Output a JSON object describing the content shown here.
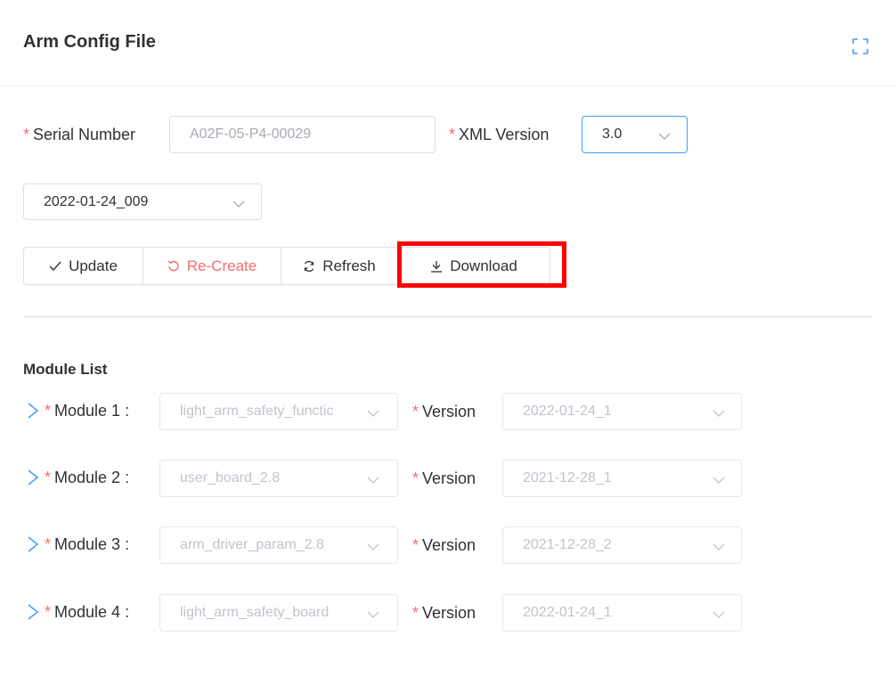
{
  "page": {
    "title": "Arm Config File"
  },
  "form": {
    "serial_label": "Serial Number",
    "serial_placeholder": "A02F-05-P4-00029",
    "xml_label": "XML Version",
    "xml_value": "3.0",
    "date_value": "2022-01-24_009",
    "required_mark": "*"
  },
  "actions": {
    "update": "Update",
    "recreate": "Re-Create",
    "refresh": "Refresh",
    "download": "Download"
  },
  "modules": {
    "title": "Module List",
    "version_label": "Version",
    "items": [
      {
        "label": "Module 1 :",
        "value": "light_arm_safety_functic",
        "version": "2022-01-24_1"
      },
      {
        "label": "Module 2 :",
        "value": "user_board_2.8",
        "version": "2021-12-28_1"
      },
      {
        "label": "Module 3 :",
        "value": "arm_driver_param_2.8",
        "version": "2021-12-28_2"
      },
      {
        "label": "Module 4 :",
        "value": "light_arm_safety_board",
        "version": "2022-01-24_1"
      }
    ]
  },
  "colors": {
    "accent": "#409eff",
    "danger": "#f56c6c",
    "highlight": "#ff0000"
  },
  "icons": [
    "fullscreen-icon",
    "check-icon",
    "refresh-ccw-icon",
    "refresh-icon",
    "download-icon",
    "chevron-down-icon",
    "chevron-right-icon"
  ]
}
